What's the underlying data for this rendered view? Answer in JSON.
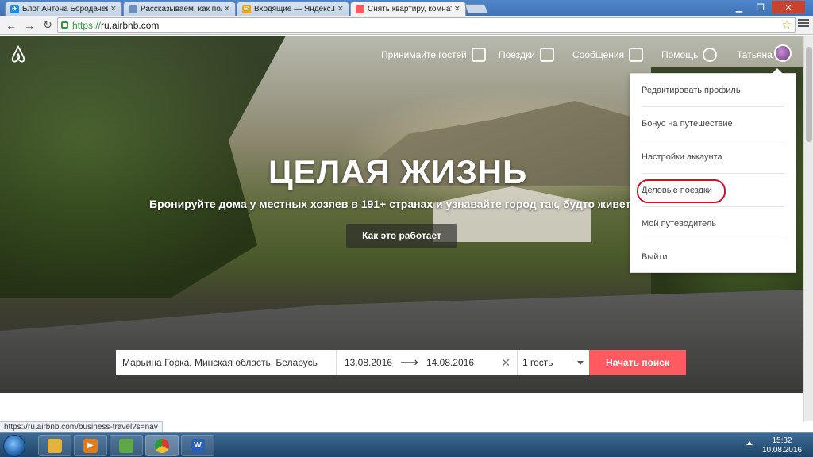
{
  "browser": {
    "tabs": [
      {
        "title": "Блог Антона Бородачёва",
        "favicon_color": "#1e88e5",
        "favicon": "airplane-icon",
        "active": false
      },
      {
        "title": "Рассказываем, как получ",
        "favicon_color": "#6c8fb8",
        "favicon": "page-icon",
        "active": false
      },
      {
        "title": "Входящие — Яндекс.Поч",
        "favicon_color": "#e8a317",
        "favicon": "mail-icon",
        "active": false
      },
      {
        "title": "Снять квартиру, комнату",
        "favicon_color": "#ff5a5f",
        "favicon": "airbnb-icon",
        "active": true
      }
    ],
    "url_secure": "https://",
    "url_host": "ru.airbnb.com",
    "status_url": "https://ru.airbnb.com/business-travel?s=nav"
  },
  "nav": {
    "host": "Принимайте гостей",
    "trips": "Поездки",
    "messages": "Сообщения",
    "help": "Помощь",
    "user_name": "Татьяна"
  },
  "dropdown": {
    "items": [
      {
        "label": "Редактировать профиль"
      },
      {
        "label": "Бонус на путешествие"
      },
      {
        "label": "Настройки аккаунта"
      },
      {
        "label": "Деловые поездки",
        "highlighted": true
      },
      {
        "label": "Мой путеводитель"
      },
      {
        "label": "Выйти"
      }
    ]
  },
  "hero": {
    "headline": "ЦЕЛАЯ ЖИЗНЬ",
    "subline": "Бронируйте дома у местных хозяев в 191+ странах и узнавайте город так, будто живете в",
    "how_button": "Как это работает"
  },
  "search": {
    "location": "Марьина Горка, Минская область, Беларусь",
    "checkin": "13.08.2016",
    "checkout": "14.08.2016",
    "guests": "1 гость",
    "submit": "Начать поиск",
    "accent_color": "#ff5a5f"
  },
  "taskbar": {
    "time": "15:32",
    "date": "10.08.2016",
    "apps": [
      {
        "name": "explorer-icon",
        "color": "#e3b341",
        "label": ""
      },
      {
        "name": "media-player-icon",
        "color": "#e07b1a",
        "label": ""
      },
      {
        "name": "photos-icon",
        "color": "#5fa84a",
        "label": ""
      },
      {
        "name": "chrome-icon",
        "color": "#d93b2f",
        "label": ""
      },
      {
        "name": "word-icon",
        "color": "#2b5fb3",
        "label": "W"
      }
    ]
  }
}
